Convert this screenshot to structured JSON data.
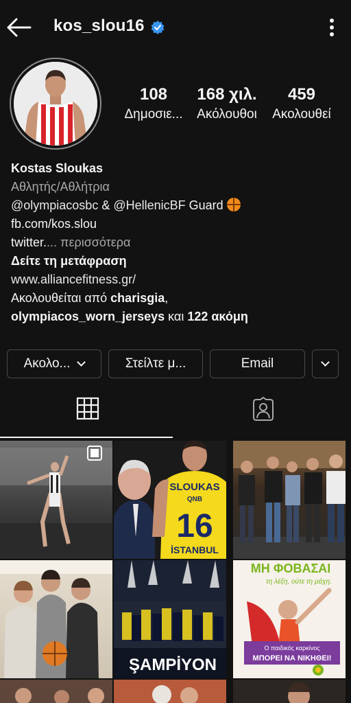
{
  "header": {
    "username": "kos_slou16"
  },
  "stats": [
    {
      "value": "108",
      "label": "Δημοσιε..."
    },
    {
      "value": "168 χιλ.",
      "label": "Ακόλουθοι"
    },
    {
      "value": "459",
      "label": "Ακολουθεί"
    }
  ],
  "bio": {
    "name": "Kostas Sloukas",
    "category": "Αθλητής/Αθλήτρια",
    "line1_mention1": "@olympiacosbc",
    "line1_amp": " & ",
    "line1_mention2": "@HellenicBF",
    "line1_rest": " Guard ",
    "line2": "fb.com/kos.slou",
    "line3_text": "twitter.",
    "line3_more": "... περισσότερα",
    "translate": "Δείτε τη μετάφραση",
    "website": "www.alliancefitness.gr/",
    "followed_prefix": "Ακολουθείται από ",
    "followed_user1": "charisgia",
    "followed_comma": ",",
    "followed_user2": "olympiacos_worn_jerseys",
    "followed_mid": " και ",
    "followed_more": "122 ακόμη"
  },
  "buttons": {
    "follow": "Ακολο...",
    "message": "Στείλτε μ...",
    "email": "Email"
  },
  "posts": {
    "jersey_name": "SLOUKAS",
    "jersey_sponsor": "QNB",
    "jersey_number": "16",
    "jersey_city": "İSTANBUL",
    "champion_text": "ŞAMPİYON",
    "poster_title": "ΜΗ ΦΟΒΑΣΑΙ",
    "poster_subtitle": "τη λέξη, ούτε τη μάχη.",
    "poster_banner1": "Ο παιδικός καρκίνος",
    "poster_banner2": "ΜΠΟΡΕΙ ΝΑ ΝΙΚΗΘΕΙ!"
  },
  "colors": {
    "background": "#121212",
    "verified": "#3897f0",
    "jersey_yellow": "#f4d91c",
    "poster_green": "#7ab51d",
    "poster_purple": "#7b3c9c"
  }
}
